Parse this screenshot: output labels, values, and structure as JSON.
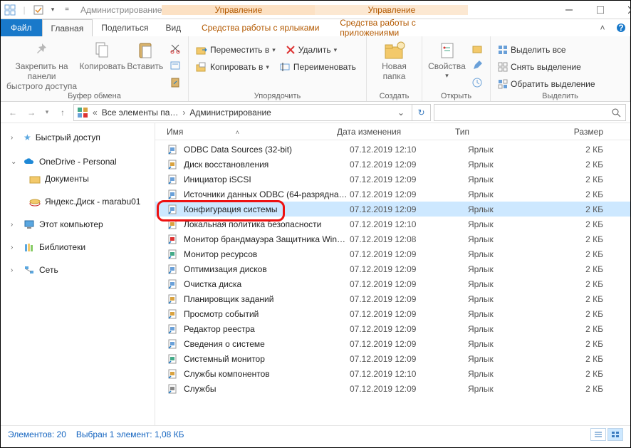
{
  "title": "Администрирование",
  "context_tabs": [
    "Управление",
    "Управление"
  ],
  "tabs": {
    "file": "Файл",
    "home": "Главная",
    "share": "Поделиться",
    "view": "Вид",
    "shortcut": "Средства работы с ярлыками",
    "apps": "Средства работы с приложениями"
  },
  "ribbon": {
    "clipboard": {
      "pin": "Закрепить на панели\nбыстрого доступа",
      "copy": "Копировать",
      "paste": "Вставить",
      "label": "Буфер обмена"
    },
    "organize": {
      "moveto": "Переместить в",
      "copyto": "Копировать в",
      "delete": "Удалить",
      "rename": "Переименовать",
      "label": "Упорядочить"
    },
    "new": {
      "newfolder": "Новая\nпапка",
      "label": "Создать"
    },
    "open": {
      "props": "Свойства",
      "label": "Открыть"
    },
    "select": {
      "all": "Выделить все",
      "none": "Снять выделение",
      "invert": "Обратить выделение",
      "label": "Выделить"
    }
  },
  "breadcrumb": {
    "root": "Все элементы па…",
    "current": "Администрирование"
  },
  "columns": {
    "name": "Имя",
    "date": "Дата изменения",
    "type": "Тип",
    "size": "Размер"
  },
  "nav": {
    "quick": "Быстрый доступ",
    "onedrive": "OneDrive - Personal",
    "docs": "Документы",
    "yadisk": "Яндекс.Диск - marabu01",
    "thispc": "Этот компьютер",
    "libs": "Библиотеки",
    "network": "Сеть"
  },
  "files": [
    {
      "name": "ODBC Data Sources (32-bit)",
      "date": "07.12.2019 12:10",
      "type": "Ярлык",
      "size": "2 КБ"
    },
    {
      "name": "Диск восстановления",
      "date": "07.12.2019 12:09",
      "type": "Ярлык",
      "size": "2 КБ"
    },
    {
      "name": "Инициатор iSCSI",
      "date": "07.12.2019 12:09",
      "type": "Ярлык",
      "size": "2 КБ"
    },
    {
      "name": "Источники данных ODBC (64-разрядна…",
      "date": "07.12.2019 12:09",
      "type": "Ярлык",
      "size": "2 КБ"
    },
    {
      "name": "Конфигурация системы",
      "date": "07.12.2019 12:09",
      "type": "Ярлык",
      "size": "2 КБ"
    },
    {
      "name": "Локальная политика безопасности",
      "date": "07.12.2019 12:10",
      "type": "Ярлык",
      "size": "2 КБ"
    },
    {
      "name": "Монитор брандмауэра Защитника Win…",
      "date": "07.12.2019 12:08",
      "type": "Ярлык",
      "size": "2 КБ"
    },
    {
      "name": "Монитор ресурсов",
      "date": "07.12.2019 12:09",
      "type": "Ярлык",
      "size": "2 КБ"
    },
    {
      "name": "Оптимизация дисков",
      "date": "07.12.2019 12:09",
      "type": "Ярлык",
      "size": "2 КБ"
    },
    {
      "name": "Очистка диска",
      "date": "07.12.2019 12:09",
      "type": "Ярлык",
      "size": "2 КБ"
    },
    {
      "name": "Планировщик заданий",
      "date": "07.12.2019 12:09",
      "type": "Ярлык",
      "size": "2 КБ"
    },
    {
      "name": "Просмотр событий",
      "date": "07.12.2019 12:09",
      "type": "Ярлык",
      "size": "2 КБ"
    },
    {
      "name": "Редактор реестра",
      "date": "07.12.2019 12:09",
      "type": "Ярлык",
      "size": "2 КБ"
    },
    {
      "name": "Сведения о системе",
      "date": "07.12.2019 12:09",
      "type": "Ярлык",
      "size": "2 КБ"
    },
    {
      "name": "Системный монитор",
      "date": "07.12.2019 12:09",
      "type": "Ярлык",
      "size": "2 КБ"
    },
    {
      "name": "Службы компонентов",
      "date": "07.12.2019 12:10",
      "type": "Ярлык",
      "size": "2 КБ"
    },
    {
      "name": "Службы",
      "date": "07.12.2019 12:09",
      "type": "Ярлык",
      "size": "2 КБ"
    }
  ],
  "selected_index": 4,
  "status": {
    "count": "Элементов: 20",
    "selection": "Выбран 1 элемент: 1,08 КБ"
  }
}
